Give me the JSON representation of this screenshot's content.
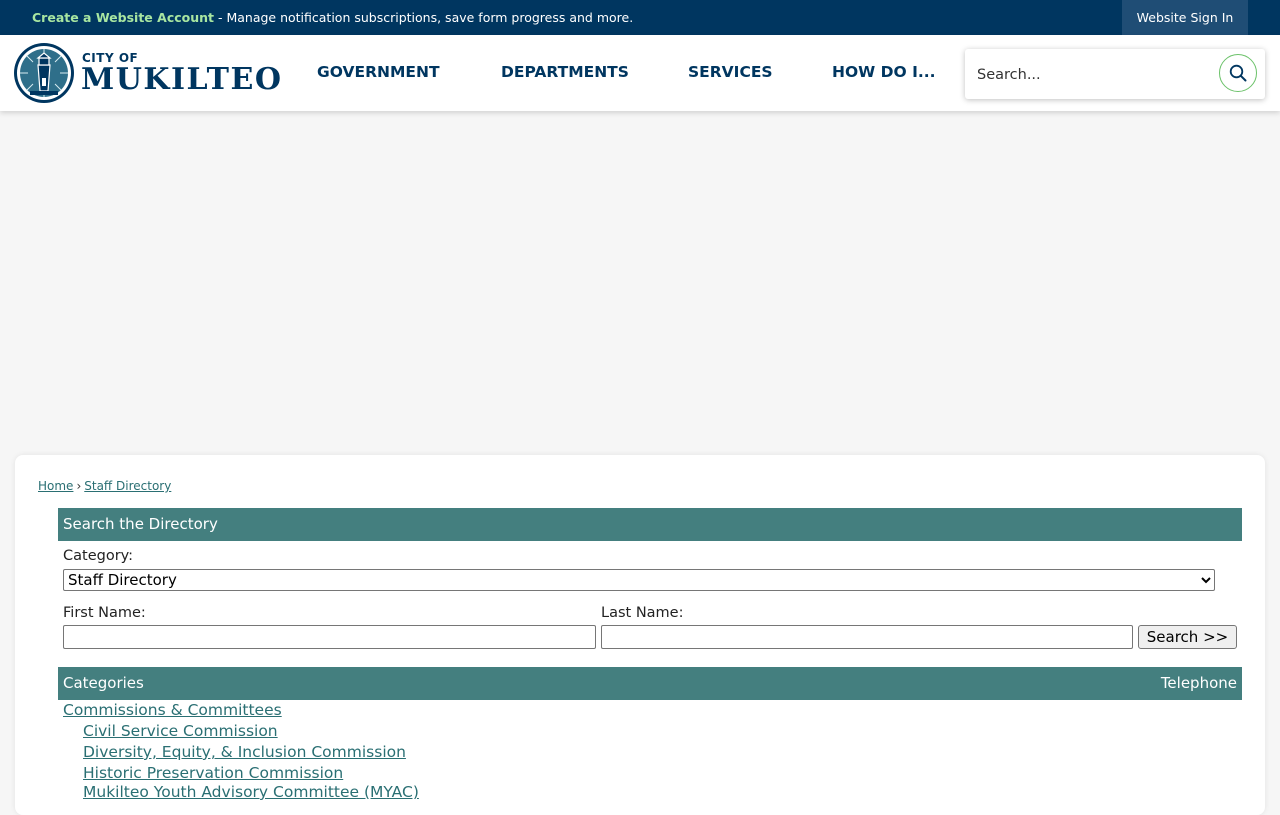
{
  "topbar": {
    "create_account": "Create a Website Account",
    "message": " - Manage notification subscriptions, save form progress and more.",
    "signin": "Website Sign In"
  },
  "logo": {
    "city_of": "CITY OF",
    "name": "MUKILTEO"
  },
  "nav": {
    "government": "GOVERNMENT",
    "departments": "DEPARTMENTS",
    "services": "SERVICES",
    "how_do_i": "HOW DO I..."
  },
  "search": {
    "placeholder": "Search..."
  },
  "breadcrumb": {
    "home": "Home",
    "separator": "›",
    "current": "Staff Directory"
  },
  "directory": {
    "header": "Search the Directory",
    "category_label": "Category:",
    "category_value": "Staff Directory",
    "first_name_label": "First Name:",
    "last_name_label": "Last Name:",
    "search_button": "Search >>"
  },
  "categories": {
    "col_categories": "Categories",
    "col_telephone": "Telephone",
    "parent": "Commissions & Committees",
    "items": [
      "Civil Service Commission",
      "Diversity, Equity, & Inclusion Commission",
      "Historic Preservation Commission",
      "Mukilteo Youth Advisory Committee (MYAC)"
    ]
  },
  "colors": {
    "topbar": "#003660",
    "accent_green": "#a8e6a1",
    "table_header": "#447f7f",
    "link": "#2a6f73"
  },
  "icons": {
    "search": "magnifier-icon",
    "logo": "lighthouse-seal-icon"
  }
}
